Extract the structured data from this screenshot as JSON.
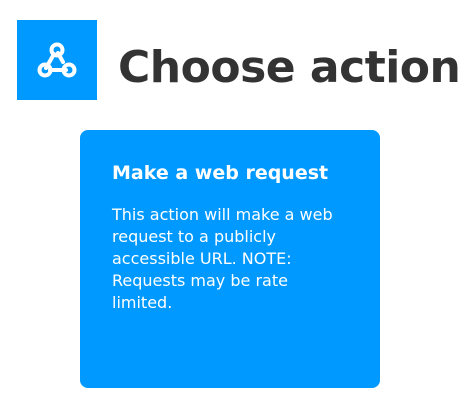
{
  "header": {
    "service_icon": "webhooks-icon",
    "title": "Choose action"
  },
  "actions": [
    {
      "title": "Make a web request",
      "description": "This action will make a web request to a publicly accessible URL. NOTE: Requests may be rate limited."
    }
  ],
  "colors": {
    "brand": "#0099ff",
    "title_text": "#333333",
    "card_text": "#ffffff",
    "background": "#ffffff"
  }
}
